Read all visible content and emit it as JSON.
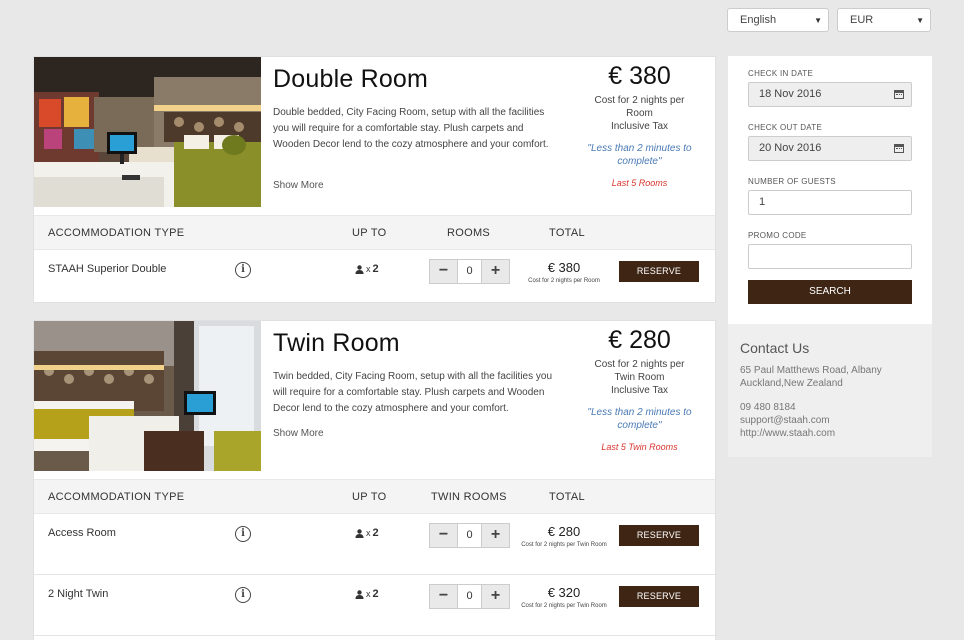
{
  "language": {
    "value": "English"
  },
  "currency": {
    "value": "EUR"
  },
  "rooms": [
    {
      "title": "Double Room",
      "description": "Double bedded, City Facing Room, setup with all the facilities you will require for a comfortable stay. Plush carpets and Wooden Decor lend to the cozy atmosphere and your comfort.",
      "show_more": "Show More",
      "price": "€ 380",
      "price_sub_1": "Cost for 2 nights per",
      "price_sub_2": "Room",
      "price_sub_3": "Inclusive Tax",
      "urgency": "\"Less than 2 minutes to complete\"",
      "left": "Last 5 Rooms",
      "headers": {
        "type": "ACCOMMODATION TYPE",
        "upto": "UP TO",
        "rooms": "ROOMS",
        "total": "TOTAL"
      },
      "rates": [
        {
          "name": "STAAH Superior Double",
          "guests": "2",
          "qty": "0",
          "total": "€ 380",
          "note": "Cost for 2 nights per Room",
          "reserve": "RESERVE"
        }
      ]
    },
    {
      "title": "Twin Room",
      "description": "Twin bedded, City Facing Room, setup with all the facilities you will require for a comfortable stay. Plush carpets and Wooden Decor lend to the cozy atmosphere and your comfort.",
      "show_more": "Show More",
      "price": "€ 280",
      "price_sub_1": "Cost for 2 nights per",
      "price_sub_2": "Twin Room",
      "price_sub_3": "Inclusive Tax",
      "urgency": "\"Less than 2 minutes to complete\"",
      "left": "Last 5 Twin Rooms",
      "headers": {
        "type": "ACCOMMODATION TYPE",
        "upto": "UP TO",
        "rooms": "TWIN ROOMS",
        "total": "TOTAL"
      },
      "rates": [
        {
          "name": "Access Room",
          "guests": "2",
          "qty": "0",
          "total": "€ 280",
          "note": "Cost for 2 nights per Twin Room",
          "reserve": "RESERVE"
        },
        {
          "name": "2 Night Twin",
          "guests": "2",
          "qty": "0",
          "total": "€ 320",
          "note": "Cost for 2 nights per Twin Room",
          "reserve": "RESERVE"
        }
      ]
    }
  ],
  "search": {
    "checkin_label": "CHECK IN DATE",
    "checkin_value": "18 Nov 2016",
    "checkout_label": "CHECK OUT DATE",
    "checkout_value": "20 Nov 2016",
    "guests_label": "NUMBER OF GUESTS",
    "guests_value": "1",
    "promo_label": "PROMO CODE",
    "promo_value": "",
    "button": "SEARCH"
  },
  "contact": {
    "title": "Contact Us",
    "address1": "65 Paul Matthews Road, Albany",
    "address2": "Auckland,New Zealand",
    "phone": "09 480 8184",
    "email": "support@staah.com",
    "web": "http://www.staah.com"
  },
  "colors": {
    "reserve_button": "#3e2514",
    "urgency": "#4a7ab5",
    "scarcity": "#d9352e"
  }
}
